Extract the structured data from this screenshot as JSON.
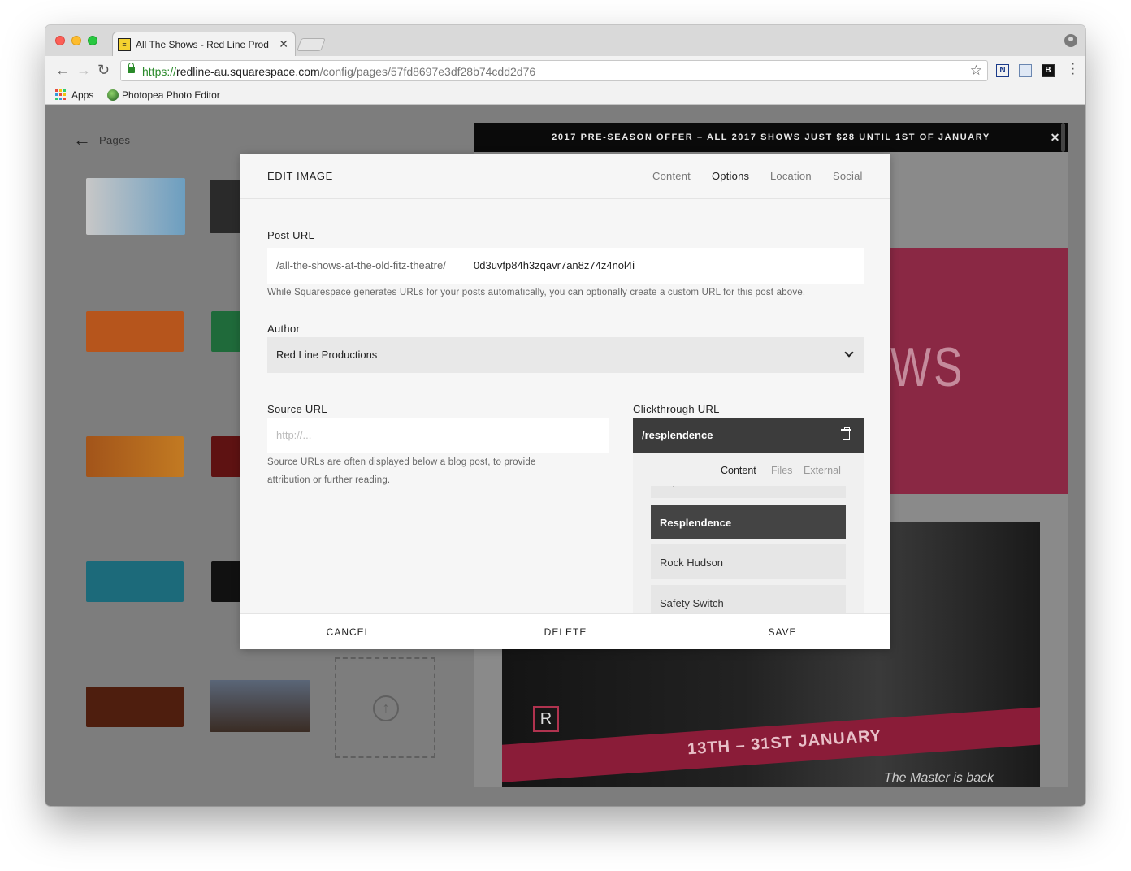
{
  "browser": {
    "tab_title": "All The Shows - Red Line Prod",
    "tab_close": "✕",
    "url_scheme": "https://",
    "url_host": "redline-au.squarespace.com",
    "url_path": "/config/pages/57fd8697e3df28b74cdd2d76",
    "bookmarks": [
      {
        "label": "Apps"
      },
      {
        "label": "Photopea Photo Editor"
      }
    ],
    "extensions": [
      "N",
      "B"
    ]
  },
  "sidebar": {
    "back_label": "Pages"
  },
  "preview": {
    "announcement": "2017 PRE-SEASON OFFER – ALL 2017 SHOWS JUST $28 UNTIL 1ST OF JANUARY",
    "announcement_close": "✕",
    "hero_text": "WS",
    "banner_text": "13TH – 31ST JANUARY",
    "tagline": "The Master is back",
    "logo_letter": "R"
  },
  "dialog": {
    "title": "EDIT IMAGE",
    "tabs": [
      "Content",
      "Options",
      "Location",
      "Social"
    ],
    "active_tab": "Options",
    "post_url": {
      "label": "Post URL",
      "prefix": "/all-the-shows-at-the-old-fitz-theatre/",
      "value": "0d3uvfp84h3zqavr7an8z74z4nol4i",
      "help": "While Squarespace generates URLs for your posts automatically, you can optionally create a custom URL for this post above."
    },
    "author": {
      "label": "Author",
      "value": "Red Line Productions"
    },
    "source_url": {
      "label": "Source URL",
      "placeholder": "http://...",
      "help_line1": "Source URLs are often displayed below a blog post, to provide",
      "help_line2": "attribution or further reading."
    },
    "clickthrough": {
      "label": "Clickthrough URL",
      "value": "/resplendence",
      "tabs": [
        "Content",
        "Files",
        "External"
      ],
      "active_tab": "Content",
      "items": [
        "Pope Head",
        "Resplendence",
        "Rock Hudson",
        "Safety Switch"
      ],
      "selected": "Resplendence"
    },
    "buttons": {
      "cancel": "CANCEL",
      "delete": "DELETE",
      "save": "SAVE"
    }
  },
  "colors": {
    "accent_dark": "#3c3c3c",
    "announcement_bg": "#0a0a0a",
    "brand_pink": "#8a2844"
  }
}
